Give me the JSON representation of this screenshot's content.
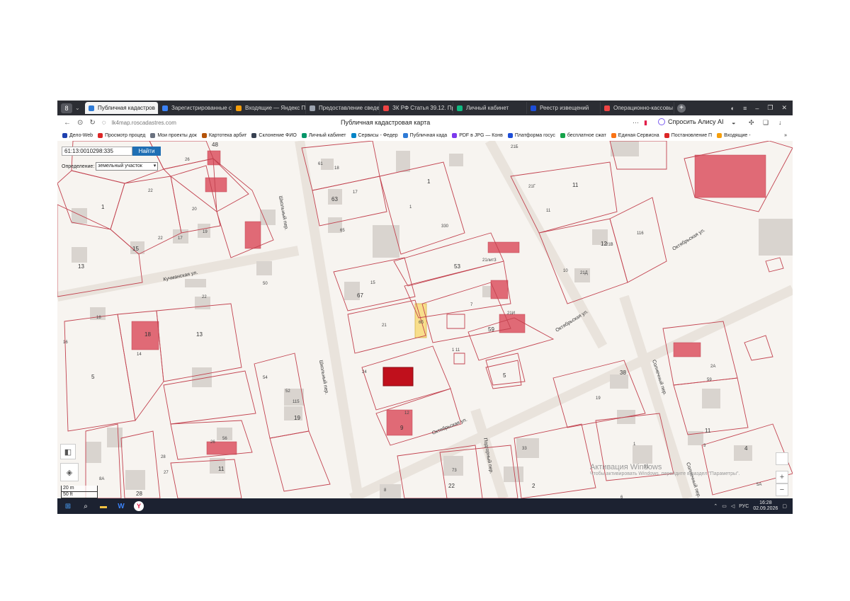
{
  "browser": {
    "tabs": [
      {
        "label": "Публичная кадастров",
        "active": true,
        "color": "#2f7bd6"
      },
      {
        "label": "Зарегистрированные со",
        "active": false,
        "color": "#3b82f6"
      },
      {
        "label": "Входящие — Яндекс По",
        "active": false,
        "color": "#f59e0b"
      },
      {
        "label": "Предоставление сведе",
        "active": false,
        "color": "#9ca3af"
      },
      {
        "label": "ЗК РФ Статья 39.12. Пр",
        "active": false,
        "color": "#ef4444"
      },
      {
        "label": "Личный кабинет",
        "active": false,
        "color": "#10b981"
      },
      {
        "label": "Реестр извещений",
        "active": false,
        "color": "#1d4ed8"
      },
      {
        "label": "Операционно-кассовы",
        "active": false,
        "color": "#ef4444"
      }
    ],
    "url": "lk4map.roscadastres.com",
    "page_title": "Публичная кадастровая карта",
    "alice_label": "Спросить Алису AI",
    "bookmarks": [
      {
        "label": "Дело-Web",
        "color": "#1e40af"
      },
      {
        "label": "Просмотр процед",
        "color": "#dc2626"
      },
      {
        "label": "Мои проекты док",
        "color": "#6b7280"
      },
      {
        "label": "Картотека арбит",
        "color": "#b45309"
      },
      {
        "label": "Склонение ФИО",
        "color": "#374151"
      },
      {
        "label": "Личный кабинет",
        "color": "#059669"
      },
      {
        "label": "Сервисы - Федер",
        "color": "#0284c7"
      },
      {
        "label": "Публичная када",
        "color": "#2f7bd6"
      },
      {
        "label": "PDF в JPG — Конв",
        "color": "#7c3aed"
      },
      {
        "label": "Платформа госус",
        "color": "#1d4ed8"
      },
      {
        "label": "бесплатное сжат",
        "color": "#16a34a"
      },
      {
        "label": "Единая Сервисна",
        "color": "#f97316"
      },
      {
        "label": "Постановление П",
        "color": "#dc2626"
      },
      {
        "label": "Входящие -",
        "color": "#f59e0b"
      }
    ]
  },
  "map": {
    "search_value": "61:13:0010298:335",
    "find_label": "Найти",
    "definition_label": "Определение:",
    "definition_value": "земельный участок",
    "scale_m": "20 m",
    "scale_ft": "50 ft",
    "watermark_title": "Активация Windows",
    "watermark_sub": "Чтобы активировать Windows, перейдите в раздел \"Параметры\".",
    "streets": [
      "Кучманская ул.",
      "Школьный пер.",
      "Школьный пер.",
      "Октябрьская ул.",
      "Октябрьская ул.",
      "Октябрьская ул.",
      "Подгорный пер.",
      "Солнечный пер.",
      "Солнечный пер."
    ],
    "parcel_labels": [
      "48",
      "26",
      "22",
      "1",
      "20",
      "19",
      "15",
      "22",
      "17",
      "13",
      "61",
      "18",
      "63",
      "17",
      "65",
      "1",
      "1",
      "330",
      "53",
      "21лит3",
      "21Б",
      "11",
      "21Г",
      "11",
      "21В",
      "21Д",
      "116",
      "12",
      "10",
      "50",
      "67",
      "15",
      "22",
      "13",
      "18",
      "16",
      "5",
      "14",
      "21",
      "6б",
      "7",
      "21И",
      "59",
      "24",
      "1 11",
      "5",
      "115",
      "52",
      "19",
      "54",
      "19",
      "38",
      "2А",
      "59",
      "11",
      "56",
      "26",
      "11",
      "28",
      "27",
      "28",
      "8А",
      "8",
      "22",
      "73",
      "33",
      "2",
      "1",
      "3",
      "4",
      "5А",
      "12",
      "9",
      "51",
      "6",
      "18",
      "40"
    ],
    "zoom_in": "+",
    "zoom_out": "−"
  },
  "taskbar": {
    "lang": "РУС",
    "time": "16:28",
    "date": "02.09.2026"
  }
}
